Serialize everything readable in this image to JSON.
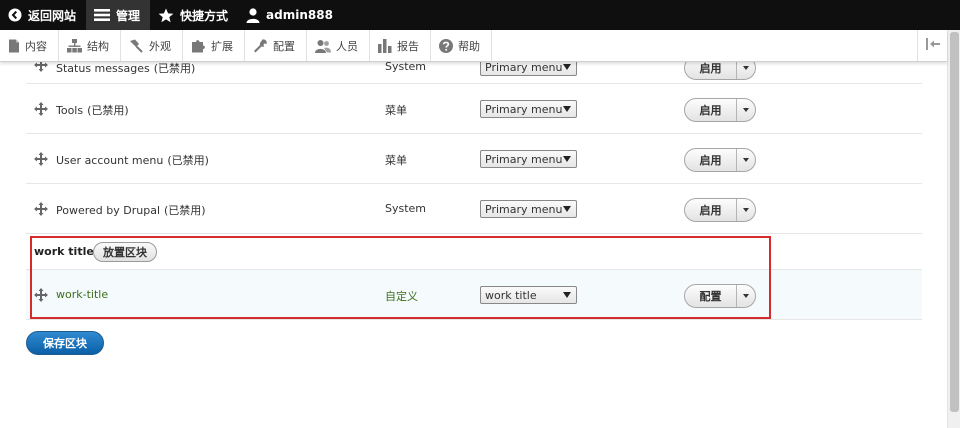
{
  "toolbar": {
    "back_label": "返回网站",
    "manage_label": "管理",
    "shortcuts_label": "快捷方式",
    "user_label": "admin888"
  },
  "tray": {
    "items": [
      {
        "label": "内容",
        "icon": "file-icon"
      },
      {
        "label": "结构",
        "icon": "structure-icon"
      },
      {
        "label": "外观",
        "icon": "paintbrush-icon"
      },
      {
        "label": "扩展",
        "icon": "puzzle-icon"
      },
      {
        "label": "配置",
        "icon": "wrench-icon"
      },
      {
        "label": "人员",
        "icon": "people-icon"
      },
      {
        "label": "报告",
        "icon": "bar-chart-icon"
      },
      {
        "label": "帮助",
        "icon": "help-icon"
      }
    ]
  },
  "rows": [
    {
      "name": "Tools",
      "disabled": "(已禁用)",
      "category": "菜单",
      "region": "Primary menu",
      "op": "启用"
    },
    {
      "name": "User account menu",
      "disabled": "(已禁用)",
      "category": "菜单",
      "region": "Primary menu",
      "op": "启用"
    },
    {
      "name": "Powered by Drupal",
      "disabled": "(已禁用)",
      "category": "System",
      "region": "Primary menu",
      "op": "启用"
    }
  ],
  "partial_row": {
    "name": "Status messages",
    "disabled": "(已禁用)",
    "category": "System",
    "region": "Primary menu",
    "op": "启用"
  },
  "work_region": {
    "heading": "work title",
    "place_block_label": "放置区块",
    "row": {
      "name": "work-title",
      "category": "自定义",
      "region": "work title",
      "op": "配置"
    }
  },
  "save_label": "保存区块",
  "colors": {
    "highlight": "#d62b2b",
    "primary_button": "#0b5fa6",
    "placed_text": "#3b6f1c"
  }
}
